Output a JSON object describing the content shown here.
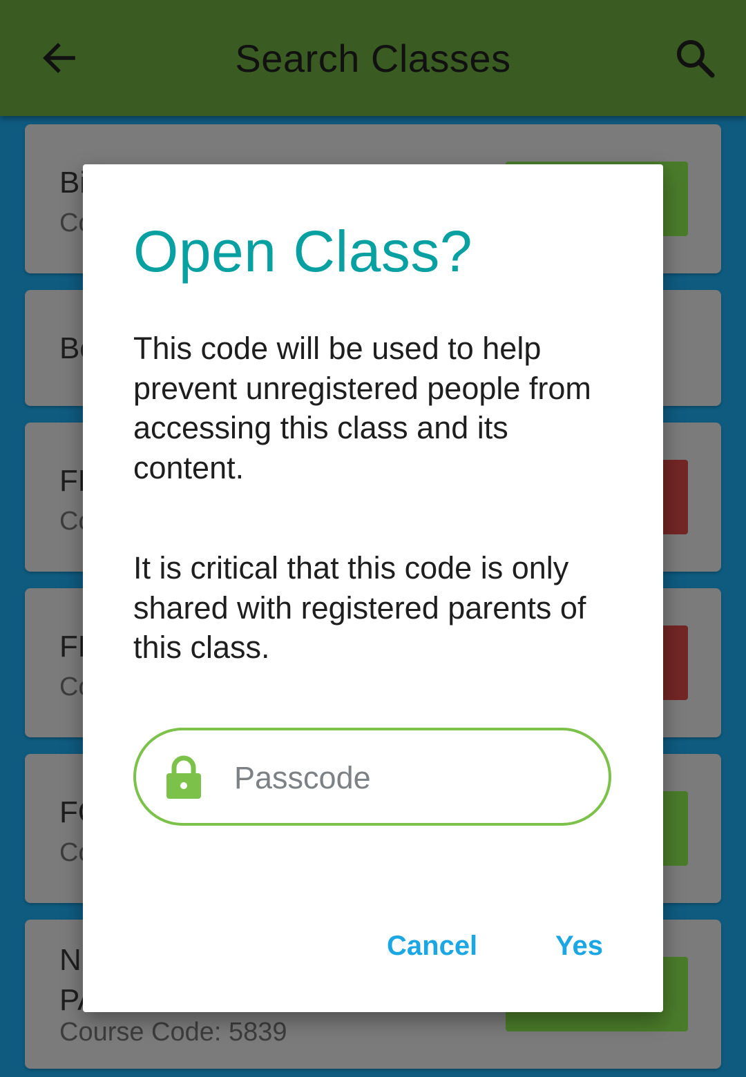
{
  "appbar": {
    "title": "Search Classes",
    "back_icon": "arrow-left-icon",
    "search_icon": "search-icon"
  },
  "list": {
    "cards": [
      {
        "name": "Bi",
        "code": "Co",
        "action_color": "#4a7b2a"
      },
      {
        "name": "Bo",
        "code": "",
        "action_color": ""
      },
      {
        "name": "FE",
        "code": "Co",
        "action_color": "#732626"
      },
      {
        "name": "FE",
        "code": "Co",
        "action_color": "#732626"
      },
      {
        "name": "FO",
        "code": "Co",
        "action_color": "#4a7b2a"
      },
      {
        "name": "N",
        "name2": "PA",
        "code": "Course Code: 5839",
        "action_color": "#4a7b2a"
      }
    ]
  },
  "dialog": {
    "title": "Open Class?",
    "paragraph1": "This code will be used to help prevent unregistered people from accessing this class and its content.",
    "paragraph2": "It is critical that this code is only shared with registered parents of this class.",
    "passcode_placeholder": "Passcode",
    "passcode_value": "",
    "lock_icon": "lock-icon",
    "cancel_label": "Cancel",
    "yes_label": "Yes"
  },
  "colors": {
    "appbar": "#3a5b22",
    "accent_title": "#08a0a0",
    "button_text": "#1ba7e3",
    "field_border": "#7cc24a"
  }
}
